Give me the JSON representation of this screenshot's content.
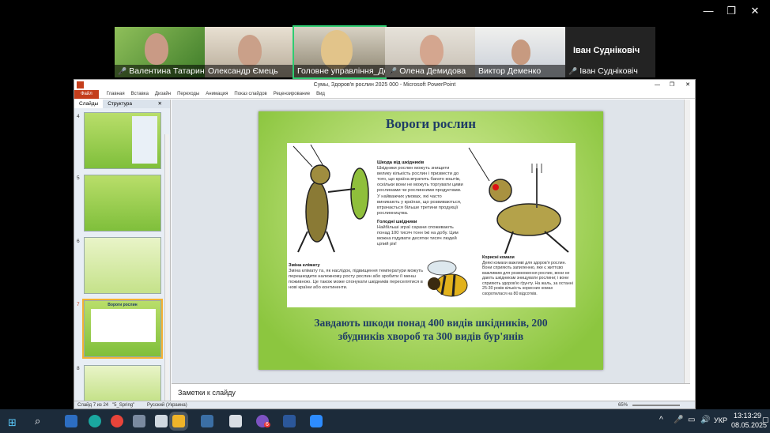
{
  "zoom_window": {
    "active_speaker_name": "Іван Судніковіч"
  },
  "participants": [
    {
      "name": "Валентина Татаринова",
      "muted": true
    },
    {
      "name": "Олександр Ємець",
      "muted": false
    },
    {
      "name": "Головне управління_Де...",
      "muted": false
    },
    {
      "name": "Олена Демидова",
      "muted": true
    },
    {
      "name": "Виктор Деменко",
      "muted": false
    },
    {
      "name": "Іван Судніковіч",
      "muted": true
    }
  ],
  "powerpoint": {
    "title": "Сумы, Здоров'я рослин 2025 000  -  Microsoft PowerPoint",
    "ribbon_tabs": [
      "Файл",
      "Главная",
      "Вставка",
      "Дизайн",
      "Переходы",
      "Анимация",
      "Показ слайдов",
      "Рецензирование",
      "Вид"
    ],
    "pane_tabs": [
      "Слайды",
      "Структура"
    ],
    "thumbnail_numbers": [
      "4",
      "5",
      "6",
      "7",
      "8"
    ],
    "thumb7_title": "Вороги рослин",
    "notes_placeholder": "Заметки к слайду",
    "status": {
      "slide": "Слайд 7 из 24",
      "theme": "\"5_Spring\"",
      "language": "Русский (Украина)",
      "zoom": "65%"
    }
  },
  "slide": {
    "title": "Вороги рослин",
    "block1_heading": "Шкода від шкідників",
    "block1_text": "Шкідники рослин можуть знищити велику кількість рослин і призвести до того, що країна втратить багато коштів, оскільки вони не можуть торгувати цими рослинами чи рослинними продуктами. У найважчих умовах, які часто виникають у країнах, що розвиваються, втрачається більше третини продукції рослинництва.",
    "block2_heading": "Голодні шкідники",
    "block2_text": "Найбільші зграї сарани споживають понад 100 тисяч тонн їжі на добу. Цим можна годувати десятки тисяч людей цілий рік!",
    "block3_heading": "Зміна клімату",
    "block3_text": "Зміна клімату та, як наслідок, підвищення температури можуть перешкодити належному росту рослин або зробити її менш поживною. Це також може спонукати шкідників переселятися в нові країни або континенти.",
    "block4_heading": "Корисні комахи",
    "block4_text": "Деякі комахи важливі для здоров'я рослин. Вони сприяють запиленню, яке є життєво важливим для розмноження рослин, вони не дають шкідникам знищувати рослини; і вони сприяють здоров'ю ґрунту. На жаль, за останні 25-30 років кількість корисних комах скоротилася на 80 відсотків.",
    "bottom_text": "Завдають шкоди понад 400 видів шкідників, 200 збудників хвороб та 300 видів бур'янів"
  },
  "taskbar": {
    "language": "УКР",
    "time": "13:13:29",
    "date": "08.05.2025",
    "badge": "6"
  }
}
